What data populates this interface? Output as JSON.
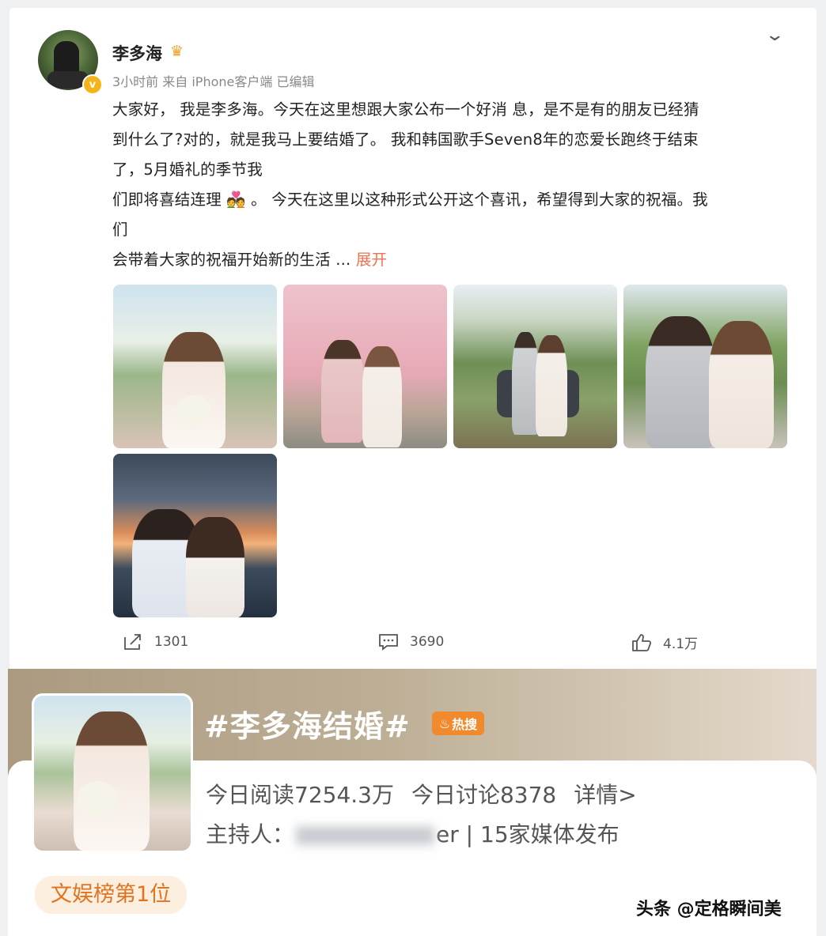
{
  "post": {
    "username": "李多海",
    "crown_icon": "crown-icon",
    "verified_icon": "verified-badge-icon",
    "verified_glyph": "v",
    "meta": "3小时前  来自 iPhone客户端  已编辑",
    "menu_icon": "chevron-down-icon",
    "lines": [
      "大家好， 我是李多海。今天在这里想跟大家公布一个好消 息，是不是有的朋友已经猜",
      "到什么了?对的，就是我马上要结婚了。 我和韩国歌手Seven8年的恋爱长跑终于结束",
      "了，5月婚礼的季节我",
      "们即将喜结连理 💑 。 今天在这里以这种形式公开这个喜讯，希望得到大家的祝福。我",
      "们",
      "会带着大家的祝福开始新的生活  ..."
    ],
    "expand_label": "展开",
    "photos": [
      "wedding-photo-porch",
      "wedding-photo-pink-house",
      "wedding-photo-car",
      "wedding-photo-couple-smile",
      "wedding-photo-sunset"
    ]
  },
  "actions": {
    "share_count": "1301",
    "comment_count": "3690",
    "like_count": "4.1万"
  },
  "topic": {
    "title": "#李多海结婚#",
    "hot_label": "热搜",
    "read_label": "今日阅读7254.3万",
    "discuss_label": "今日讨论8378",
    "detail_label": "详情>",
    "host_prefix": "主持人：",
    "host_suffix": "er",
    "host_media": "| 15家媒体发布",
    "rank_label": "文娱榜第1位"
  },
  "watermark": "头条 @定格瞬间美",
  "colors": {
    "accent": "#eb7350",
    "hot": "#f08a2c",
    "rank": "#e2731f"
  }
}
